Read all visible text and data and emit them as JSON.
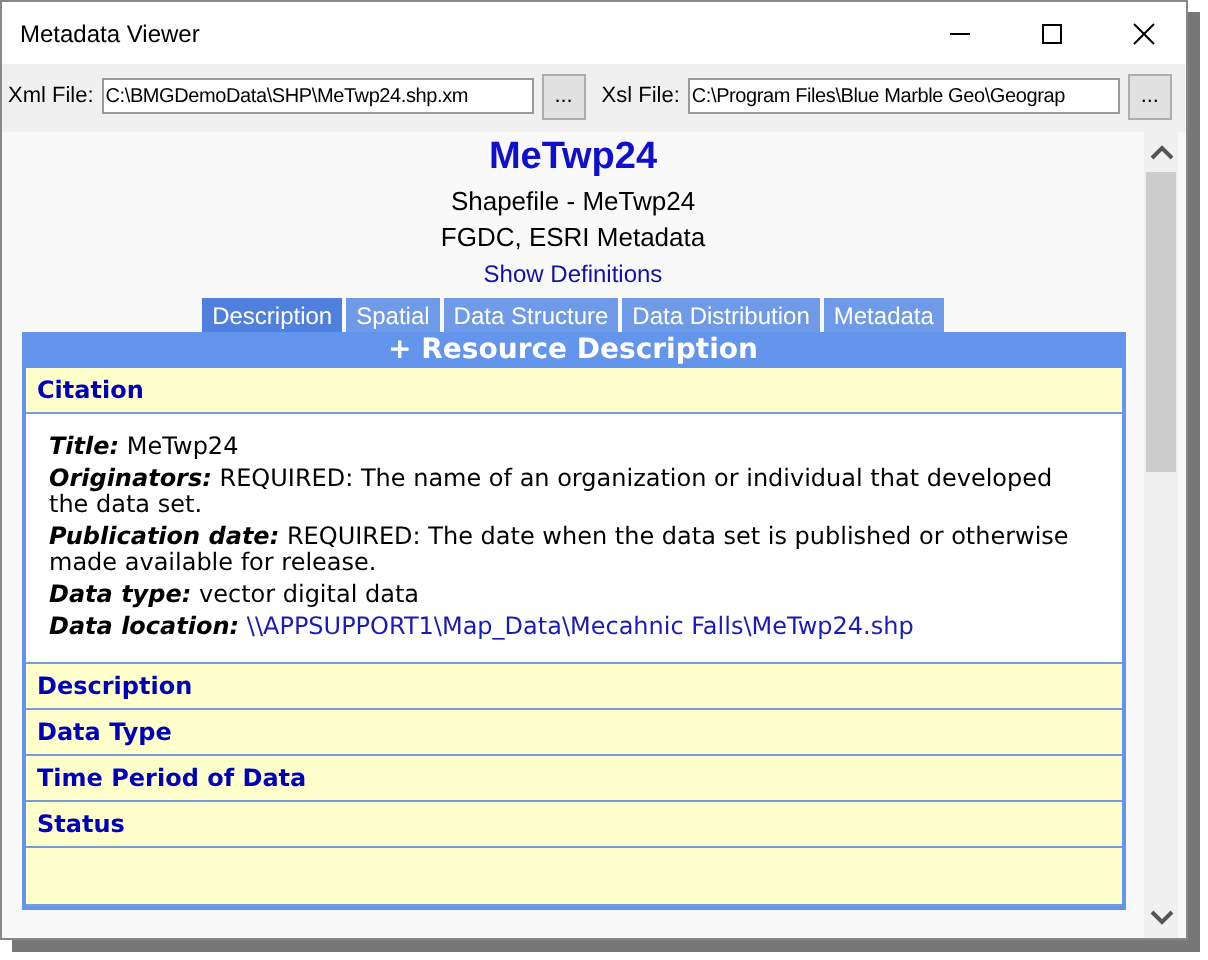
{
  "window": {
    "title": "Metadata Viewer"
  },
  "toolbar": {
    "xml_label": "Xml File:",
    "xml_value": "C:\\BMGDemoData\\SHP\\MeTwp24.shp.xm",
    "xml_browse": "...",
    "xsl_label": "Xsl File:",
    "xsl_value": "C:\\Program Files\\Blue Marble Geo\\Geograp",
    "xsl_browse": "..."
  },
  "document": {
    "title": "MeTwp24",
    "subtitle": "Shapefile - MeTwp24",
    "standard": "FGDC, ESRI Metadata",
    "definitions_link": "Show Definitions",
    "tabs": [
      {
        "label": "Description",
        "selected": true
      },
      {
        "label": "Spatial",
        "selected": false
      },
      {
        "label": "Data Structure",
        "selected": false
      },
      {
        "label": "Data Distribution",
        "selected": false
      },
      {
        "label": "Metadata",
        "selected": false
      }
    ],
    "section_header": "+ Resource Description",
    "sections": [
      {
        "title": "Citation",
        "fields": [
          {
            "label": "Title:",
            "value": "MeTwp24",
            "kind": "text"
          },
          {
            "label": "Originators:",
            "value": "REQUIRED: The name of an organization or individual that developed the data set.",
            "kind": "text"
          },
          {
            "label": "Publication date:",
            "value": "REQUIRED: The date when the data set is published or otherwise made available for release.",
            "kind": "text"
          },
          {
            "label": "Data type:",
            "value": "vector digital data",
            "kind": "text"
          },
          {
            "label": "Data location:",
            "value": "\\\\APPSUPPORT1\\Map_Data\\Mecahnic Falls\\MeTwp24.shp",
            "kind": "link"
          }
        ]
      },
      {
        "title": "Description"
      },
      {
        "title": "Data Type"
      },
      {
        "title": "Time Period of Data"
      },
      {
        "title": "Status"
      }
    ]
  }
}
